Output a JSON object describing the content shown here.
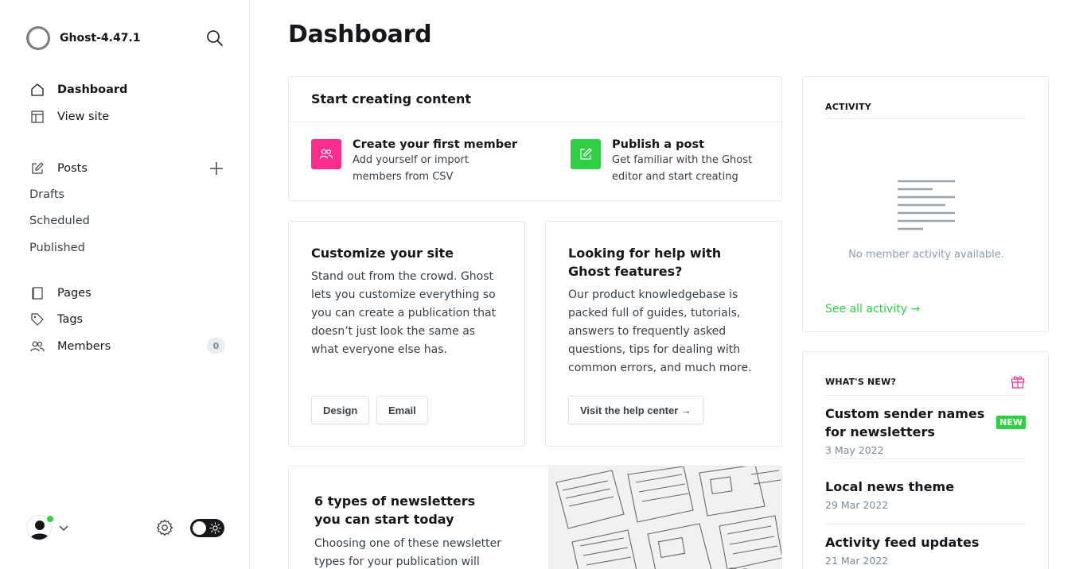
{
  "brand": {
    "name": "Ghost-4.47.1"
  },
  "nav": {
    "dashboard": "Dashboard",
    "view_site": "View site",
    "posts": "Posts",
    "drafts": "Drafts",
    "scheduled": "Scheduled",
    "published": "Published",
    "pages": "Pages",
    "tags": "Tags",
    "members": "Members",
    "members_count": "0"
  },
  "page": {
    "title": "Dashboard"
  },
  "start": {
    "heading": "Start creating content",
    "member_title": "Create your first member",
    "member_desc": "Add yourself or import members from CSV",
    "post_title": "Publish a post",
    "post_desc": "Get familiar with the Ghost editor and start creating",
    "member_color": "#fb2d8d",
    "post_color": "#30cf43"
  },
  "customize": {
    "title": "Customize your site",
    "desc": "Stand out from the crowd. Ghost lets you customize everything so you can create a publication that doesn’t just look the same as what everyone else has.",
    "design_btn": "Design",
    "email_btn": "Email"
  },
  "help": {
    "title": "Looking for help with Ghost features?",
    "desc": "Our product knowledgebase is packed full of guides, tutorials, answers to frequently asked questions, tips for dealing with common errors, and much more.",
    "button": "Visit the help center →"
  },
  "newsletter": {
    "title": "6 types of newsletters you can start today",
    "desc": "Choosing one of these newsletter types for your publication will help"
  },
  "activity": {
    "label": "ACTIVITY",
    "empty": "No member activity available.",
    "see_all": "See all activity →"
  },
  "whatsnew": {
    "label": "WHAT'S NEW?",
    "badge": "NEW",
    "items": [
      {
        "title": "Custom sender names for newsletters",
        "date": "3 May 2022"
      },
      {
        "title": "Local news theme",
        "date": "29 Mar 2022"
      },
      {
        "title": "Activity feed updates",
        "date": "21 Mar 2022"
      }
    ]
  },
  "colors": {
    "accent": "#30cf43",
    "pink": "#fb2d8d"
  }
}
